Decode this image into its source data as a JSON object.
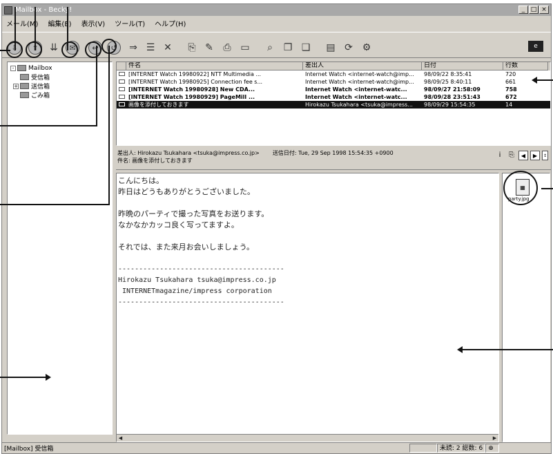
{
  "window": {
    "title": "Mailbox - Becky!",
    "controls": [
      "_",
      "□",
      "×"
    ]
  },
  "menu": [
    "メール(M)",
    "編集(E)",
    "表示(V)",
    "ツール(T)",
    "ヘルプ(H)"
  ],
  "toolbar": {
    "buttons": [
      {
        "icon": "receive-icon",
        "glyph": "⇩"
      },
      {
        "icon": "send-icon",
        "glyph": "⇧"
      },
      {
        "icon": "receive-all-icon",
        "glyph": "⇊"
      },
      {
        "icon": "new-mail-icon",
        "glyph": "✉"
      },
      {
        "icon": "reply-icon",
        "glyph": "↩"
      },
      {
        "icon": "reply-all-icon",
        "glyph": "↺"
      },
      {
        "icon": "forward-icon",
        "glyph": "⇒"
      },
      {
        "icon": "list-icon",
        "glyph": "☰"
      },
      {
        "icon": "delete-icon",
        "glyph": "✕"
      },
      {
        "icon": "attach-icon",
        "glyph": "⎘"
      },
      {
        "icon": "edit-icon",
        "glyph": "✎"
      },
      {
        "icon": "print-icon",
        "glyph": "⎙"
      },
      {
        "icon": "preview-icon",
        "glyph": "▭"
      },
      {
        "icon": "find-icon",
        "glyph": "⌕"
      },
      {
        "icon": "copy-icon",
        "glyph": "❐"
      },
      {
        "icon": "paste-icon",
        "glyph": "❑"
      },
      {
        "icon": "address-book-icon",
        "glyph": "▤"
      },
      {
        "icon": "sync-icon",
        "glyph": "⟳"
      },
      {
        "icon": "settings-icon",
        "glyph": "⚙"
      }
    ],
    "right_icon": "ie-logo-icon"
  },
  "folders": [
    {
      "label": "Mailbox",
      "level": 0,
      "expand": "-"
    },
    {
      "label": "受信箱",
      "level": 1,
      "expand": ""
    },
    {
      "label": "送信箱",
      "level": 1,
      "expand": "+"
    },
    {
      "label": "ごみ箱",
      "level": 1,
      "expand": ""
    }
  ],
  "columns": [
    "",
    "件名",
    "差出人",
    "日付",
    "行数"
  ],
  "messages": [
    {
      "subject": "[INTERNET Watch 19980922] NTT Multimedia ...",
      "from": "Internet Watch <internet-watch@imp...",
      "date": "98/09/22 8:35:41",
      "lines": "720",
      "bold": false,
      "selected": false
    },
    {
      "subject": "[INTERNET Watch 19980925] Connection fee s...",
      "from": "Internet Watch <internet-watch@imp...",
      "date": "98/09/25 8:40:11",
      "lines": "661",
      "bold": false,
      "selected": false
    },
    {
      "subject": "[INTERNET Watch 19980928] New CDA...",
      "from": "Internet Watch <internet-watc...",
      "date": "98/09/27 21:58:09",
      "lines": "758",
      "bold": true,
      "selected": false
    },
    {
      "subject": "[INTERNET Watch 19980929] PageMill ...",
      "from": "Internet Watch <internet-watc...",
      "date": "98/09/28 23:51:43",
      "lines": "672",
      "bold": true,
      "selected": false
    },
    {
      "subject": "画像を添付しておきます",
      "from": "Hirokazu Tsukahara <tsuka@impress...",
      "date": "98/09/29 15:54:35",
      "lines": "14",
      "bold": false,
      "selected": true
    }
  ],
  "header": {
    "from_label": "差出人:",
    "from": "Hirokazu Tsukahara <tsuka@impress.co.jp>",
    "date_label": "送信日付:",
    "date": "Tue, 29 Sep 1998 15:54:35 +0900",
    "subject_label": "件名:",
    "subject": "画像を添付しておきます"
  },
  "body": [
    "こんにちは。",
    "昨日はどうもありがとうございました。",
    "",
    "昨晩のパーティで撮った写真をお送ります。",
    "なかなかカッコ良く写ってますよ。",
    "",
    "それでは、また来月お会いしましょう。",
    "",
    "----------------------------------------",
    "Hirokazu Tsukahara tsuka@impress.co.jp",
    " INTERNETmagazine/impress corporation",
    "----------------------------------------"
  ],
  "attachment": {
    "name": "party.jpg"
  },
  "status": {
    "folder": "[Mailbox] 受信箱",
    "unread_label": "未読:",
    "unread": "2",
    "total_label": "総数:",
    "total": "6"
  }
}
